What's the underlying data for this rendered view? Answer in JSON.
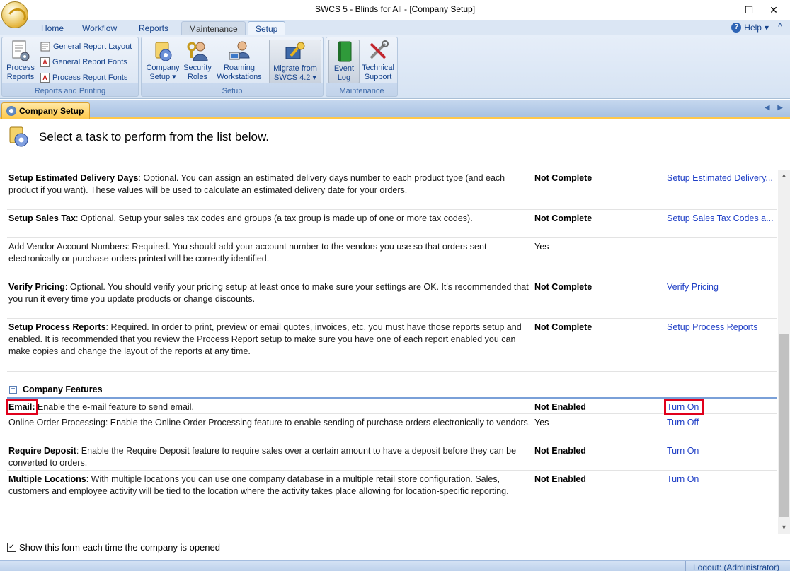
{
  "window": {
    "title": "SWCS 5 - Blinds for All - [Company Setup]",
    "minimize": "—",
    "maximize": "☐",
    "close": "✕"
  },
  "ribbon_tabs": [
    "Home",
    "Workflow",
    "Reports",
    "Maintenance",
    "Setup"
  ],
  "help": {
    "label": "Help",
    "dropdown": "▾",
    "minimize": "˄"
  },
  "ribbon": {
    "reports_group": {
      "label": "Reports and Printing",
      "process_reports": "Process Reports",
      "general_report_layout": "General Report Layout",
      "general_report_fonts": "General Report Fonts",
      "process_report_fonts": "Process Report Fonts"
    },
    "setup_group": {
      "label": "Setup",
      "company_setup": "Company Setup ▾",
      "security_roles": "Security Roles",
      "roaming_workstations": "Roaming Workstations",
      "migrate": "Migrate from SWCS 4.2 ▾"
    },
    "maintenance_group": {
      "label": "Maintenance",
      "event_log": "Event Log",
      "technical_support": "Technical Support"
    }
  },
  "doc_tab": {
    "label": "Company Setup",
    "nav": "◀ ▶"
  },
  "header": {
    "text": "Select a task to perform from the list below."
  },
  "tasks": [
    {
      "title": "Setup Estimated Delivery Days",
      "text": ": Optional. You can assign an estimated delivery days number to each product type (and each product if you want). These values will be used to calculate an estimated delivery date for your orders.",
      "status": "Not Complete",
      "action": "Setup Estimated Delivery..."
    },
    {
      "title": "Setup Sales Tax",
      "text": ": Optional. Setup your sales tax codes and groups (a tax group is made up of one or more tax codes).",
      "status": "Not Complete",
      "action": "Setup Sales Tax Codes a..."
    },
    {
      "title": "",
      "text": "Add Vendor Account Numbers: Required. You should add your account number to the vendors you use so that orders sent electronically or purchase orders printed will be correctly identified.",
      "status": "Yes",
      "action": ""
    },
    {
      "title": "Verify Pricing",
      "text": ": Optional. You should verify your pricing setup at least once to make sure your settings are OK. It's recommended that you run it every time you update products or change discounts.",
      "status": "Not Complete",
      "action": "Verify Pricing"
    },
    {
      "title": "Setup Process Reports",
      "text": ": Required. In order to print, preview or email quotes, invoices, etc. you must have those reports setup and enabled. It is recommended that you review the Process Report setup to make sure you have one of each report enabled you can make copies and change the layout of the reports at any time.",
      "status": "Not Complete",
      "action": "Setup Process Reports"
    }
  ],
  "features_section": {
    "title": "Company Features",
    "toggle": "−"
  },
  "features": [
    {
      "title": "Email:",
      "text": " Enable the e-mail feature to send email.",
      "status": "Not Enabled",
      "action": "Turn On"
    },
    {
      "title": "",
      "text": "Online Order Processing: Enable the Online Order Processing feature to enable sending of purchase orders electronically to vendors.",
      "status": "Yes",
      "action": "Turn Off"
    },
    {
      "title": "Require Deposit",
      "text": ": Enable the Require Deposit feature to require sales over a certain amount to have a deposit before they can be converted to orders.",
      "status": "Not Enabled",
      "action": "Turn On"
    },
    {
      "title": "Multiple Locations",
      "text": ": With multiple locations you can use one company database in a multiple retail store configuration. Sales, customers and employee activity will be tied to the location where the activity takes place allowing for location-specific reporting.",
      "status": "Not Enabled",
      "action": "Turn On"
    }
  ],
  "footer": {
    "show_form_label": "Show this form each time the company is opened",
    "checked_mark": "✓"
  },
  "statusbar": {
    "logout": "Logout: (Administrator)"
  },
  "colors": {
    "link": "#1f3fc6",
    "highlight_box": "#e0001b",
    "ribbon_text": "#15428b"
  }
}
